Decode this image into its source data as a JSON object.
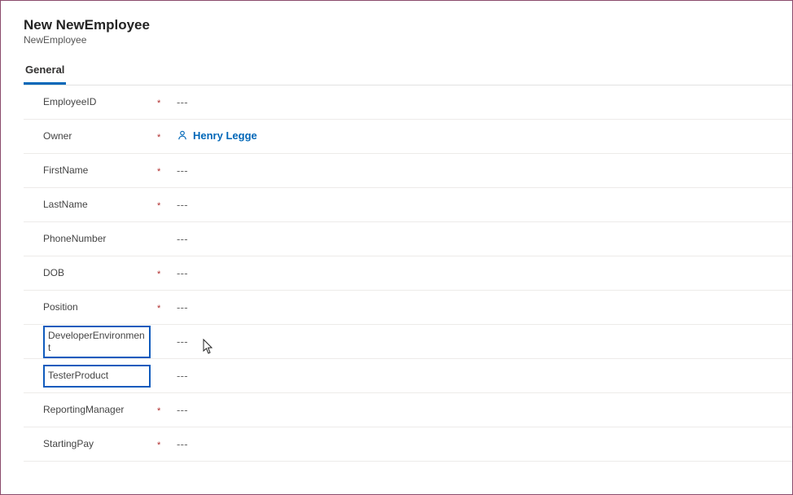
{
  "header": {
    "title": "New NewEmployee",
    "subtitle": "NewEmployee"
  },
  "tabs": {
    "general": {
      "label": "General"
    }
  },
  "fields": {
    "employeeId": {
      "label": "EmployeeID",
      "required": "*",
      "value": "---"
    },
    "owner": {
      "label": "Owner",
      "required": "*",
      "value": "Henry Legge"
    },
    "firstName": {
      "label": "FirstName",
      "required": "*",
      "value": "---"
    },
    "lastName": {
      "label": "LastName",
      "required": "*",
      "value": "---"
    },
    "phoneNumber": {
      "label": "PhoneNumber",
      "required": "",
      "value": "---"
    },
    "dob": {
      "label": "DOB",
      "required": "*",
      "value": "---"
    },
    "position": {
      "label": "Position",
      "required": "*",
      "value": "---"
    },
    "devEnv": {
      "label": "DeveloperEnvironment",
      "required": "",
      "value": "---"
    },
    "testerProduct": {
      "label": "TesterProduct",
      "required": "",
      "value": "---"
    },
    "reportingMgr": {
      "label": "ReportingManager",
      "required": "*",
      "value": "---"
    },
    "startingPay": {
      "label": "StartingPay",
      "required": "*",
      "value": "---"
    }
  },
  "colors": {
    "accent": "#0067b8",
    "highlightBox": "#0f5bbd"
  }
}
